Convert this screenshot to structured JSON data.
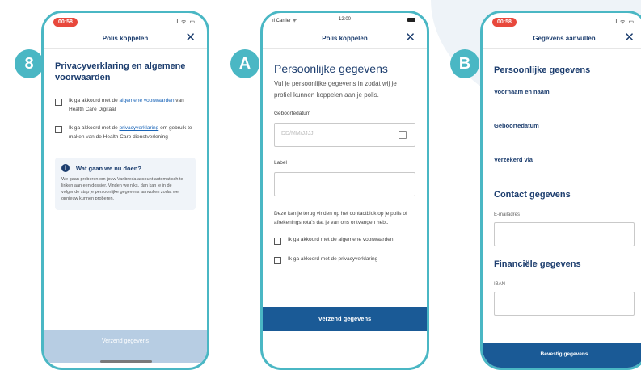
{
  "screen1": {
    "badge": "8",
    "time": "00:58",
    "status_icons": "ıl ᯤ ▭",
    "title": "Polis koppelen",
    "heading": "Privacyverklaring en algemene voorwaarden",
    "check1_pre": "Ik ga akkoord met de ",
    "check1_link": "algemene voorwaarden",
    "check1_post": " van Health Care Digitaal",
    "check2_pre": "Ik ga akkoord met de ",
    "check2_link": "privacyverklaring",
    "check2_post": " om gebruik te maken van de Health Care dienstverlening",
    "info_title": "Wat gaan we nu doen?",
    "info_body": "We gaan proberen om jouw Vanbreda account automatisch te linken aan een dossier. Vinden we niks, dan kan je in de volgende stap je persoonlijke gegevens aanvullen zodat we opnieuw kunnen proberen.",
    "button": "Verzend gegevens"
  },
  "screen2": {
    "badge": "A",
    "carrier": "ıl Carrier ᯤ",
    "time": "12:00",
    "title": "Polis koppelen",
    "heading": "Persoonlijke gegevens",
    "subtitle": "Vul je persoonlijke gegevens in zodat wij je profiel kunnen koppelen aan je polis.",
    "birthdate_label": "Geboortedatum",
    "birthdate_placeholder": "DD/MM/JJJJ",
    "label_label": "Label",
    "note": "Deze kan je terug vinden op het contactblok op je polis of afrekeningsnota's dat je van ons ontvangen hebt.",
    "check1": "Ik ga akkoord met de algemene voorwaarden",
    "check2": "Ik ga akkoord met de privacyverklaring",
    "button": "Verzend gegevens"
  },
  "screen3": {
    "badge": "B",
    "time": "00:58",
    "status_icons": "ıl ᯤ ▭",
    "title": "Gegevens aanvullen",
    "section1": "Persoonlijke gegevens",
    "field1": "Voornaam en naam",
    "field2": "Geboortedatum",
    "field3": "Verzekerd via",
    "section2": "Contact gegevens",
    "email_label": "E-mailadres",
    "section3": "Financiële gegevens",
    "iban_label": "IBAN",
    "button": "Bevestig gegevens"
  },
  "colors": {
    "teal": "#4ab7c4",
    "navy": "#1c3d6e",
    "button_blue": "#1a5a96",
    "disabled": "#b7cde3",
    "red": "#e8483c"
  }
}
